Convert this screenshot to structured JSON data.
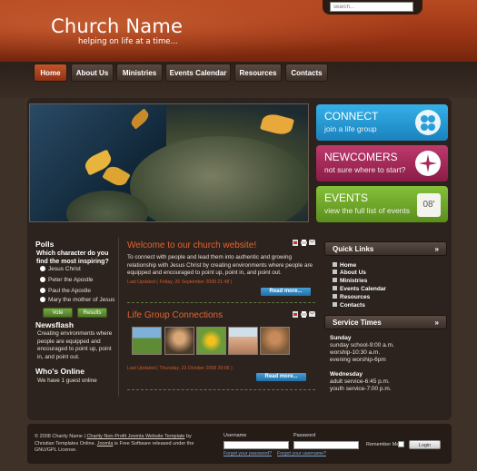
{
  "header": {
    "title": "Church Name",
    "slogan": "helping on life at a time...",
    "search_placeholder": "search..."
  },
  "nav": [
    "Home",
    "About Us",
    "Ministries",
    "Events Calendar",
    "Resources",
    "Contacts"
  ],
  "promos": [
    {
      "title": "CONNECT",
      "sub": "join a life group",
      "color": "#2a9fd8"
    },
    {
      "title": "NEWCOMERS",
      "sub": "not sure where to start?",
      "color": "#a9285a"
    },
    {
      "title": "EVENTS",
      "sub": "view the full list of events",
      "color": "#72aa2a",
      "badge": "08'"
    }
  ],
  "poll": {
    "heading": "Polls",
    "question": "Which character do you find the most inspiring?",
    "options": [
      "Jesus Christ",
      "Peter the Apostle",
      "Paul the Apostle",
      "Mary the mother of Jesus"
    ],
    "vote": "Vote",
    "results": "Results"
  },
  "newsflash": {
    "heading": "Newsflash",
    "text": "Creating environments where people are equipped and encouraged to point up, point in, and point out."
  },
  "whos_online": {
    "heading": "Who's Online",
    "text": "We have 1 guest online"
  },
  "articles": [
    {
      "title": "Welcome to our church website!",
      "body": "To connect with people and lead them into authentic and growing relationship with Jesus Christ by creating environments where people are equipped and encouraged to point up, point in, and point out.",
      "updated": "Last Updated ( Friday, 26 September 2008 21:48 )",
      "readmore": "Read more..."
    },
    {
      "title": "Life Group Connections",
      "updated": "Last Updated ( Thursday, 23 October 2008 20:06 )",
      "readmore": "Read more..."
    }
  ],
  "quick_links": {
    "heading": "Quick Links",
    "items": [
      "Home",
      "About Us",
      "Ministries",
      "Events Calendar",
      "Resources",
      "Contacts"
    ]
  },
  "service_times": {
    "heading": "Service Times",
    "sunday_label": "Sunday",
    "sunday": [
      "sunday school-9:00 a.m.",
      "worship-10:30 a.m.",
      "evening worship-6pm"
    ],
    "wednesday_label": "Wednesday",
    "wednesday": [
      "adult service-6:45 p.m.",
      "youth service-7:00 p.m."
    ]
  },
  "footer": {
    "copyright_a": "© 2008 Charity Name |",
    "link_template": "Charity Non-Profit Joomla Website Template",
    "copyright_b": "by Christian Templates Online.",
    "link_joomla": "Joomla",
    "copyright_c": "is Free Software released under the GNU/GPL License.",
    "username_label": "Username",
    "password_label": "Password",
    "remember": "Remember Me",
    "login": "Login",
    "forgot_password": "Forgot your password?",
    "forgot_username": "Forgot your username?"
  }
}
